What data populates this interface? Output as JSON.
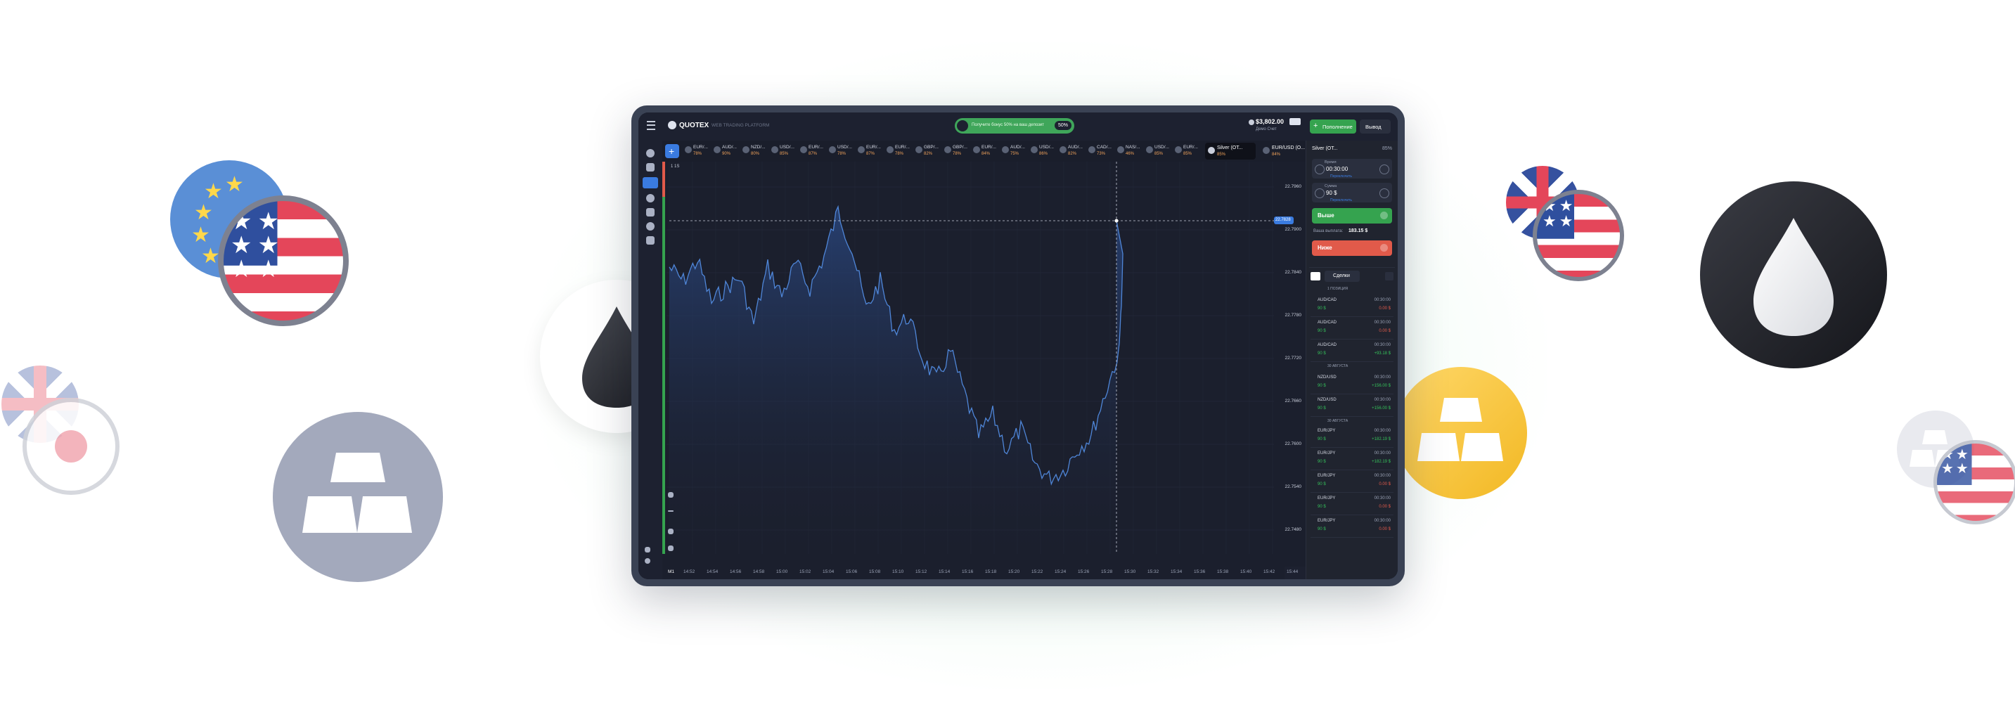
{
  "app": {
    "logo_text": "QUOTEX",
    "subtitle": "WEB TRADING PLATFORM",
    "promo_text": "Получите бонус 50% на ваш депозит",
    "promo_badge": "50%",
    "balance": "$3,802.00",
    "balance_sub": "Демо Счет",
    "deposit_label": "Пополнение",
    "withdraw_label": "Вывод",
    "active_asset": "Silver (OT...",
    "active_asset_pct": "85%",
    "next_asset": "EUR/USD (O...",
    "next_asset_pct": "84%"
  },
  "assets_strip": [
    {
      "name": "EUR/...",
      "pct": "78%"
    },
    {
      "name": "AUD/...",
      "pct": "90%"
    },
    {
      "name": "NZD/...",
      "pct": "80%"
    },
    {
      "name": "USD/...",
      "pct": "85%"
    },
    {
      "name": "EUR/...",
      "pct": "87%"
    },
    {
      "name": "USD/...",
      "pct": "78%"
    },
    {
      "name": "EUR/...",
      "pct": "87%"
    },
    {
      "name": "EUR/...",
      "pct": "78%"
    },
    {
      "name": "GBP/...",
      "pct": "82%"
    },
    {
      "name": "GBP/...",
      "pct": "78%"
    },
    {
      "name": "EUR/...",
      "pct": "84%"
    },
    {
      "name": "AUD/...",
      "pct": "75%"
    },
    {
      "name": "USD/...",
      "pct": "86%"
    },
    {
      "name": "AUD/...",
      "pct": "82%"
    },
    {
      "name": "CAD/...",
      "pct": "73%"
    },
    {
      "name": "NAS/...",
      "pct": "46%"
    },
    {
      "name": "USD/...",
      "pct": "85%"
    },
    {
      "name": "EUR/...",
      "pct": "85%"
    }
  ],
  "chart": {
    "timeframe_label": "1 1S",
    "price_tag": "22.7828",
    "y_ticks": [
      "22.7960",
      "22.7900",
      "22.7840",
      "22.7780",
      "22.7720",
      "22.7660",
      "22.7600",
      "22.7540",
      "22.7480"
    ],
    "x_ticks": [
      "14:52",
      "14:54",
      "14:56",
      "14:58",
      "15:00",
      "15:02",
      "15:04",
      "15:06",
      "15:08",
      "15:10",
      "15:12",
      "15:14",
      "15:16",
      "15:18",
      "15:20",
      "15:22",
      "15:24",
      "15:26",
      "15:28",
      "15:30",
      "15:32",
      "15:34",
      "15:36",
      "15:38",
      "15:40",
      "15:42",
      "15:44"
    ],
    "bottom_left": "M1"
  },
  "panel": {
    "time_label": "Время",
    "time_value": "00:30:00",
    "time_sub": "Переключить",
    "amount_label": "Сумма",
    "amount_value": "90 $",
    "amount_sub": "Переключить",
    "up_label": "Выше",
    "down_label": "Ниже",
    "payout_label": "Ваша выплата:",
    "payout_value": "183.15 $",
    "trades_tab": "Сделки",
    "trades_group1": "1 ПОЗИЦИЯ",
    "trades_group2": "30 АВГУСТА",
    "trades_group3": "30 АВГУСТА"
  },
  "trades": [
    {
      "pair": "AUD/CAD",
      "time": "00:30:00",
      "amt": "90 $",
      "res": "0.00 $",
      "res_color": "#e15a4a"
    },
    {
      "pair": "AUD/CAD",
      "time": "00:30:00",
      "amt": "90 $",
      "res": "0.00 $",
      "res_color": "#e15a4a"
    },
    {
      "pair": "AUD/CAD",
      "time": "00:30:00",
      "amt": "90 $",
      "res": "+93.18 $",
      "res_color": "#35c05a"
    },
    {
      "pair": "NZD/USD",
      "time": "00:30:00",
      "amt": "90 $",
      "res": "+156.00 $",
      "res_color": "#35c05a"
    },
    {
      "pair": "NZD/USD",
      "time": "00:30:00",
      "amt": "90 $",
      "res": "+156.00 $",
      "res_color": "#35c05a"
    },
    {
      "pair": "EUR/JPY",
      "time": "00:30:00",
      "amt": "90 $",
      "res": "+182.19 $",
      "res_color": "#35c05a"
    },
    {
      "pair": "EUR/JPY",
      "time": "00:30:00",
      "amt": "90 $",
      "res": "+182.19 $",
      "res_color": "#35c05a"
    },
    {
      "pair": "EUR/JPY",
      "time": "00:30:00",
      "amt": "90 $",
      "res": "0.00 $",
      "res_color": "#e15a4a"
    },
    {
      "pair": "EUR/JPY",
      "time": "00:30:00",
      "amt": "90 $",
      "res": "0.00 $",
      "res_color": "#e15a4a"
    },
    {
      "pair": "EUR/JPY",
      "time": "00:30:00",
      "amt": "90 $",
      "res": "0.00 $",
      "res_color": "#e15a4a"
    }
  ],
  "colors": {
    "accent_green": "#35a34f",
    "accent_red": "#e15a4a",
    "line_blue": "#4f86d8",
    "gold": "#f6c431",
    "silver": "#a3a9bc",
    "dark": "#1d1f26"
  }
}
